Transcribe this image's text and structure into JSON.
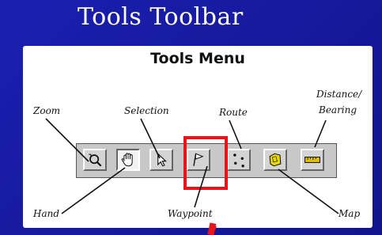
{
  "slide": {
    "title": "Tools Toolbar",
    "menu_title": "Tools Menu"
  },
  "labels": {
    "zoom": "Zoom",
    "selection": "Selection",
    "route": "Route",
    "distance_line1": "Distance/",
    "distance_line2": "Bearing",
    "hand": "Hand",
    "waypoint": "Waypoint",
    "map": "Map"
  },
  "toolbar": {
    "tools": [
      "zoom",
      "hand",
      "selection",
      "waypoint",
      "route",
      "map",
      "distance-bearing"
    ],
    "active_tool": "hand",
    "highlighted_tool": "waypoint"
  },
  "colors": {
    "background": "#1a1fb0",
    "highlight": "#e8141c",
    "map_icon": "#e8d800",
    "ruler_icon": "#e0c000"
  }
}
